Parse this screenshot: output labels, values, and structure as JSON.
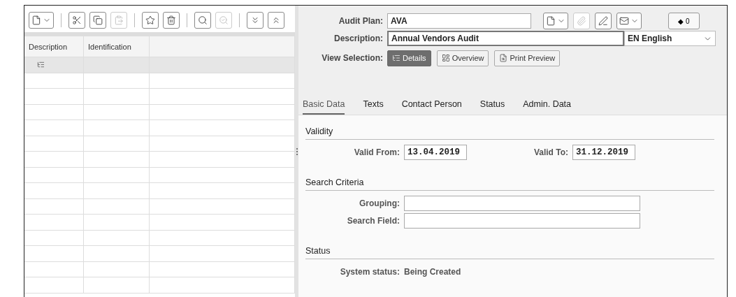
{
  "toolbar": [
    {
      "kind": "dropdown",
      "disabled": false
    },
    {
      "kind": "separator"
    },
    {
      "kind": "button",
      "disabled": false
    },
    {
      "kind": "button",
      "disabled": false
    },
    {
      "kind": "button",
      "disabled": true
    },
    {
      "kind": "separator"
    },
    {
      "kind": "button",
      "disabled": false
    },
    {
      "kind": "button",
      "disabled": false
    },
    {
      "kind": "separator"
    },
    {
      "kind": "button",
      "disabled": false
    },
    {
      "kind": "button",
      "disabled": true
    },
    {
      "kind": "separator"
    },
    {
      "kind": "button",
      "disabled": false
    },
    {
      "kind": "button",
      "disabled": false
    }
  ],
  "table": {
    "columns": [
      "Description",
      "Identification"
    ],
    "rows": [
      {
        "kind": "root",
        "selected": true
      }
    ]
  },
  "header": {
    "audit_plan": {
      "label": "Audit Plan:",
      "value": "AVA"
    },
    "description": {
      "label": "Description:",
      "value": "Annual Vendors Audit",
      "language": "EN English"
    },
    "actions": [
      {
        "kind": "dropdown",
        "disabled": false
      },
      {
        "kind": "button",
        "disabled": true
      },
      {
        "kind": "button",
        "disabled": false
      },
      {
        "kind": "dropdown",
        "disabled": false
      }
    ],
    "counter": "◆ 0",
    "view_selection": {
      "label": "View Selection:",
      "options": [
        {
          "label": "Details",
          "selected": true
        },
        {
          "label": "Overview",
          "selected": false
        },
        {
          "label": "Print Preview",
          "selected": false
        }
      ]
    }
  },
  "tabs": [
    {
      "label": "Basic Data",
      "selected": true
    },
    {
      "label": "Texts",
      "selected": false
    },
    {
      "label": "Contact Person",
      "selected": false
    },
    {
      "label": "Status",
      "selected": false
    },
    {
      "label": "Admin. Data",
      "selected": false
    }
  ],
  "sections": [
    {
      "title": "Validity",
      "rows": [
        [
          {
            "kind": "date",
            "label": "Valid From:",
            "value": "13.04.2019"
          },
          {
            "kind": "date",
            "label": "Valid To:",
            "value": "31.12.2019"
          }
        ]
      ]
    },
    {
      "title": "Search Criteria",
      "rows": [
        [
          {
            "kind": "input",
            "label": "Grouping:"
          }
        ],
        [
          {
            "kind": "input",
            "label": "Search Field:"
          }
        ]
      ]
    },
    {
      "title": "Status",
      "rows": [
        [
          {
            "kind": "text",
            "label": "System status:",
            "value": "Being Created"
          }
        ]
      ]
    }
  ]
}
